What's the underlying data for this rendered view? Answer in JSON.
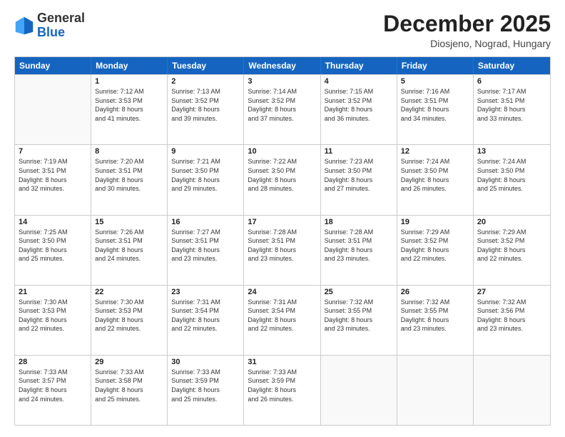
{
  "header": {
    "logo_general": "General",
    "logo_blue": "Blue",
    "month_title": "December 2025",
    "subtitle": "Diosjeno, Nograd, Hungary"
  },
  "calendar": {
    "days": [
      "Sunday",
      "Monday",
      "Tuesday",
      "Wednesday",
      "Thursday",
      "Friday",
      "Saturday"
    ],
    "rows": [
      [
        {
          "day": "",
          "sunrise": "",
          "sunset": "",
          "daylight": "",
          "empty": true
        },
        {
          "day": "1",
          "sunrise": "Sunrise: 7:12 AM",
          "sunset": "Sunset: 3:53 PM",
          "daylight": "Daylight: 8 hours",
          "daylight2": "and 41 minutes."
        },
        {
          "day": "2",
          "sunrise": "Sunrise: 7:13 AM",
          "sunset": "Sunset: 3:52 PM",
          "daylight": "Daylight: 8 hours",
          "daylight2": "and 39 minutes."
        },
        {
          "day": "3",
          "sunrise": "Sunrise: 7:14 AM",
          "sunset": "Sunset: 3:52 PM",
          "daylight": "Daylight: 8 hours",
          "daylight2": "and 37 minutes."
        },
        {
          "day": "4",
          "sunrise": "Sunrise: 7:15 AM",
          "sunset": "Sunset: 3:52 PM",
          "daylight": "Daylight: 8 hours",
          "daylight2": "and 36 minutes."
        },
        {
          "day": "5",
          "sunrise": "Sunrise: 7:16 AM",
          "sunset": "Sunset: 3:51 PM",
          "daylight": "Daylight: 8 hours",
          "daylight2": "and 34 minutes."
        },
        {
          "day": "6",
          "sunrise": "Sunrise: 7:17 AM",
          "sunset": "Sunset: 3:51 PM",
          "daylight": "Daylight: 8 hours",
          "daylight2": "and 33 minutes."
        }
      ],
      [
        {
          "day": "7",
          "sunrise": "Sunrise: 7:19 AM",
          "sunset": "Sunset: 3:51 PM",
          "daylight": "Daylight: 8 hours",
          "daylight2": "and 32 minutes."
        },
        {
          "day": "8",
          "sunrise": "Sunrise: 7:20 AM",
          "sunset": "Sunset: 3:51 PM",
          "daylight": "Daylight: 8 hours",
          "daylight2": "and 30 minutes."
        },
        {
          "day": "9",
          "sunrise": "Sunrise: 7:21 AM",
          "sunset": "Sunset: 3:50 PM",
          "daylight": "Daylight: 8 hours",
          "daylight2": "and 29 minutes."
        },
        {
          "day": "10",
          "sunrise": "Sunrise: 7:22 AM",
          "sunset": "Sunset: 3:50 PM",
          "daylight": "Daylight: 8 hours",
          "daylight2": "and 28 minutes."
        },
        {
          "day": "11",
          "sunrise": "Sunrise: 7:23 AM",
          "sunset": "Sunset: 3:50 PM",
          "daylight": "Daylight: 8 hours",
          "daylight2": "and 27 minutes."
        },
        {
          "day": "12",
          "sunrise": "Sunrise: 7:24 AM",
          "sunset": "Sunset: 3:50 PM",
          "daylight": "Daylight: 8 hours",
          "daylight2": "and 26 minutes."
        },
        {
          "day": "13",
          "sunrise": "Sunrise: 7:24 AM",
          "sunset": "Sunset: 3:50 PM",
          "daylight": "Daylight: 8 hours",
          "daylight2": "and 25 minutes."
        }
      ],
      [
        {
          "day": "14",
          "sunrise": "Sunrise: 7:25 AM",
          "sunset": "Sunset: 3:50 PM",
          "daylight": "Daylight: 8 hours",
          "daylight2": "and 25 minutes."
        },
        {
          "day": "15",
          "sunrise": "Sunrise: 7:26 AM",
          "sunset": "Sunset: 3:51 PM",
          "daylight": "Daylight: 8 hours",
          "daylight2": "and 24 minutes."
        },
        {
          "day": "16",
          "sunrise": "Sunrise: 7:27 AM",
          "sunset": "Sunset: 3:51 PM",
          "daylight": "Daylight: 8 hours",
          "daylight2": "and 23 minutes."
        },
        {
          "day": "17",
          "sunrise": "Sunrise: 7:28 AM",
          "sunset": "Sunset: 3:51 PM",
          "daylight": "Daylight: 8 hours",
          "daylight2": "and 23 minutes."
        },
        {
          "day": "18",
          "sunrise": "Sunrise: 7:28 AM",
          "sunset": "Sunset: 3:51 PM",
          "daylight": "Daylight: 8 hours",
          "daylight2": "and 23 minutes."
        },
        {
          "day": "19",
          "sunrise": "Sunrise: 7:29 AM",
          "sunset": "Sunset: 3:52 PM",
          "daylight": "Daylight: 8 hours",
          "daylight2": "and 22 minutes."
        },
        {
          "day": "20",
          "sunrise": "Sunrise: 7:29 AM",
          "sunset": "Sunset: 3:52 PM",
          "daylight": "Daylight: 8 hours",
          "daylight2": "and 22 minutes."
        }
      ],
      [
        {
          "day": "21",
          "sunrise": "Sunrise: 7:30 AM",
          "sunset": "Sunset: 3:53 PM",
          "daylight": "Daylight: 8 hours",
          "daylight2": "and 22 minutes."
        },
        {
          "day": "22",
          "sunrise": "Sunrise: 7:30 AM",
          "sunset": "Sunset: 3:53 PM",
          "daylight": "Daylight: 8 hours",
          "daylight2": "and 22 minutes."
        },
        {
          "day": "23",
          "sunrise": "Sunrise: 7:31 AM",
          "sunset": "Sunset: 3:54 PM",
          "daylight": "Daylight: 8 hours",
          "daylight2": "and 22 minutes."
        },
        {
          "day": "24",
          "sunrise": "Sunrise: 7:31 AM",
          "sunset": "Sunset: 3:54 PM",
          "daylight": "Daylight: 8 hours",
          "daylight2": "and 22 minutes."
        },
        {
          "day": "25",
          "sunrise": "Sunrise: 7:32 AM",
          "sunset": "Sunset: 3:55 PM",
          "daylight": "Daylight: 8 hours",
          "daylight2": "and 23 minutes."
        },
        {
          "day": "26",
          "sunrise": "Sunrise: 7:32 AM",
          "sunset": "Sunset: 3:55 PM",
          "daylight": "Daylight: 8 hours",
          "daylight2": "and 23 minutes."
        },
        {
          "day": "27",
          "sunrise": "Sunrise: 7:32 AM",
          "sunset": "Sunset: 3:56 PM",
          "daylight": "Daylight: 8 hours",
          "daylight2": "and 23 minutes."
        }
      ],
      [
        {
          "day": "28",
          "sunrise": "Sunrise: 7:33 AM",
          "sunset": "Sunset: 3:57 PM",
          "daylight": "Daylight: 8 hours",
          "daylight2": "and 24 minutes."
        },
        {
          "day": "29",
          "sunrise": "Sunrise: 7:33 AM",
          "sunset": "Sunset: 3:58 PM",
          "daylight": "Daylight: 8 hours",
          "daylight2": "and 25 minutes."
        },
        {
          "day": "30",
          "sunrise": "Sunrise: 7:33 AM",
          "sunset": "Sunset: 3:59 PM",
          "daylight": "Daylight: 8 hours",
          "daylight2": "and 25 minutes."
        },
        {
          "day": "31",
          "sunrise": "Sunrise: 7:33 AM",
          "sunset": "Sunset: 3:59 PM",
          "daylight": "Daylight: 8 hours",
          "daylight2": "and 26 minutes."
        },
        {
          "day": "",
          "sunrise": "",
          "sunset": "",
          "daylight": "",
          "daylight2": "",
          "empty": true
        },
        {
          "day": "",
          "sunrise": "",
          "sunset": "",
          "daylight": "",
          "daylight2": "",
          "empty": true
        },
        {
          "day": "",
          "sunrise": "",
          "sunset": "",
          "daylight": "",
          "daylight2": "",
          "empty": true
        }
      ]
    ]
  }
}
